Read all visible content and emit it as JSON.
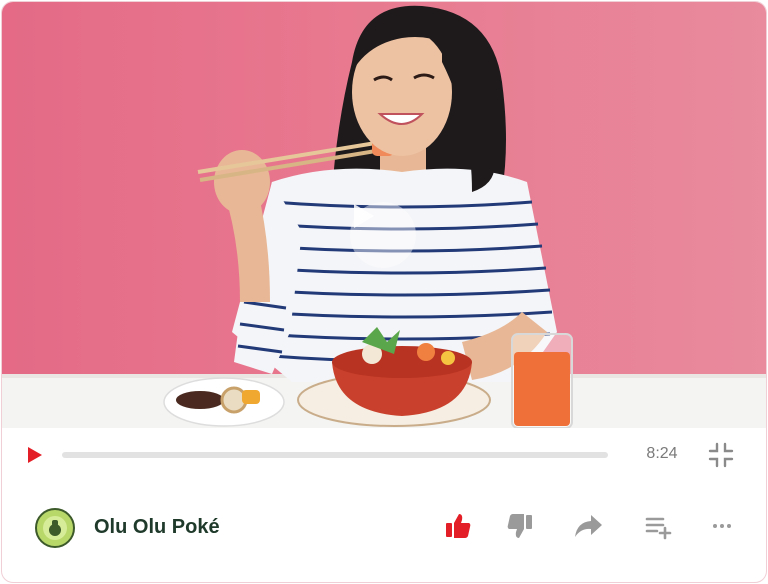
{
  "player": {
    "duration": "8:24",
    "progress_fraction": 0
  },
  "channel": {
    "name": "Olu Olu Poké",
    "logo_text": "OLU OLU POKÉ"
  },
  "colors": {
    "accent": "#e41e26",
    "background": "#e8798f",
    "icon_muted": "#9a9a9a"
  },
  "icons": {
    "play": "play-icon",
    "fullscreen": "exit-fullscreen-icon",
    "like": "thumbs-up-icon",
    "dislike": "thumbs-down-icon",
    "share": "share-icon",
    "save": "add-to-playlist-icon",
    "more": "more-icon"
  }
}
